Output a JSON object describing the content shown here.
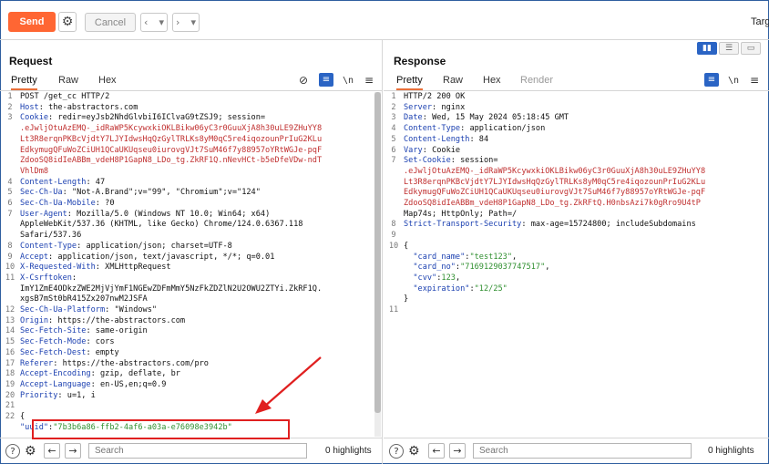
{
  "toolbar": {
    "send_label": "Send",
    "cancel_label": "Cancel",
    "target_label": "Targ",
    "icons": [
      "gear-icon",
      "chevron-left-icon",
      "chevron-right-icon"
    ]
  },
  "request": {
    "title": "Request",
    "tabs": [
      "Pretty",
      "Raw",
      "Hex"
    ],
    "active_tab": "Pretty",
    "search_placeholder": "Search",
    "highlights": "0 highlights",
    "lines": [
      {
        "n": "1",
        "text": "POST /get_cc HTTP/2"
      },
      {
        "n": "2",
        "key": "Host",
        "val": " the-abstractors.com"
      },
      {
        "n": "3",
        "key": "Cookie",
        "val": " redir=eyJsb2NhdGlvbiI6IClvaG9tZSJ9; session="
      },
      {
        "n": "",
        "cont": ".eJwljOtuAzEMQ-_idRaWP5KcywxkiOKLBikw06yC3r0GuuXjA8h30uLE9ZHuYY8"
      },
      {
        "n": "",
        "cont": "Lt3R8erqnPKBcVjdtY7LJYIdwsHqQzGylTRLKs8yM0qC5re4iqozounPrIuG2KLu"
      },
      {
        "n": "",
        "cont": "EdkymugQFuWoZCiUH1QCaUKUqseu0iurovgVJt7SuM46f7y88957oYRtWGJe-pqF"
      },
      {
        "n": "",
        "cont": "ZdooSQ8idIeABBm_vdeH8P1GapN8_LDo_tg.ZkRF1Q.nNevHCt-b5eDfeVDw-ndT"
      },
      {
        "n": "",
        "cont": "VhlDm8"
      },
      {
        "n": "4",
        "key": "Content-Length",
        "val": " 47"
      },
      {
        "n": "5",
        "key": "Sec-Ch-Ua",
        "val": " \"Not-A.Brand\";v=\"99\", \"Chromium\";v=\"124\""
      },
      {
        "n": "6",
        "key": "Sec-Ch-Ua-Mobile",
        "val": " ?0"
      },
      {
        "n": "7",
        "key": "User-Agent",
        "val": " Mozilla/5.0 (Windows NT 10.0; Win64; x64)"
      },
      {
        "n": "",
        "text": "AppleWebKit/537.36 (KHTML, like Gecko) Chrome/124.0.6367.118"
      },
      {
        "n": "",
        "text": "Safari/537.36"
      },
      {
        "n": "8",
        "key": "Content-Type",
        "val": " application/json; charset=UTF-8"
      },
      {
        "n": "9",
        "key": "Accept",
        "val": " application/json, text/javascript, */*; q=0.01"
      },
      {
        "n": "10",
        "key": "X-Requested-With",
        "val": " XMLHttpRequest"
      },
      {
        "n": "11",
        "key": "X-Csrftoken",
        "val": ""
      },
      {
        "n": "",
        "text": "ImY1ZmE4ODkzZWE2MjVjYmF1NGEwZDFmMmY5NzFkZDZlN2U2OWU2ZTYi.ZkRF1Q."
      },
      {
        "n": "",
        "text": "xgsB7mSt0bR415Zx207nwM2JSFA"
      },
      {
        "n": "12",
        "key": "Sec-Ch-Ua-Platform",
        "val": " \"Windows\""
      },
      {
        "n": "13",
        "key": "Origin",
        "val": " https://the-abstractors.com"
      },
      {
        "n": "14",
        "key": "Sec-Fetch-Site",
        "val": " same-origin"
      },
      {
        "n": "15",
        "key": "Sec-Fetch-Mode",
        "val": " cors"
      },
      {
        "n": "16",
        "key": "Sec-Fetch-Dest",
        "val": " empty"
      },
      {
        "n": "17",
        "key": "Referer",
        "val": " https://the-abstractors.com/pro"
      },
      {
        "n": "18",
        "key": "Accept-Encoding",
        "val": " gzip, deflate, br"
      },
      {
        "n": "19",
        "key": "Accept-Language",
        "val": " en-US,en;q=0.9"
      },
      {
        "n": "20",
        "key": "Priority",
        "val": " u=1, i"
      },
      {
        "n": "21",
        "text": ""
      },
      {
        "n": "22",
        "text": "{"
      },
      {
        "n": "",
        "jkey": "\"uuid\"",
        "jsep": ":",
        "jval": "\"7b3b6a86-ffb2-4af6-a03a-e76098e3942b\""
      }
    ]
  },
  "response": {
    "title": "Response",
    "tabs": [
      "Pretty",
      "Raw",
      "Hex",
      "Render"
    ],
    "active_tab": "Pretty",
    "search_placeholder": "Search",
    "highlights": "0 highlights",
    "lines": [
      {
        "n": "1",
        "text": "HTTP/2 200 OK"
      },
      {
        "n": "2",
        "key": "Server",
        "val": " nginx"
      },
      {
        "n": "3",
        "key": "Date",
        "val": " Wed, 15 May 2024 05:18:45 GMT"
      },
      {
        "n": "4",
        "key": "Content-Type",
        "val": " application/json"
      },
      {
        "n": "5",
        "key": "Content-Length",
        "val": " 84"
      },
      {
        "n": "6",
        "key": "Vary",
        "val": " Cookie"
      },
      {
        "n": "7",
        "key": "Set-Cookie",
        "val": " session="
      },
      {
        "n": "",
        "cont": ".eJwljOtuAzEMQ-_idRaWP5KcywxkiOKLBikw06yC3r0GuuXjA8h30uLE9ZHuYY8"
      },
      {
        "n": "",
        "cont": "Lt3R8erqnPKBcVjdtY7LJYIdwsHqQzGylTRLKs8yM0qC5re4iqozounPrIuG2KLu"
      },
      {
        "n": "",
        "cont": "EdkymugQFuWoZCiUH1QCaUKUqseu0iurovgVJt7SuM46f7y88957oYRtWGJe-pqF"
      },
      {
        "n": "",
        "cont": "ZdooSQ8idIeABBm_vdeH8P1GapN8_LDo_tg.ZkRFtQ.H0nbsAzi7k0gRro9U4tP"
      },
      {
        "n": "",
        "text": "Map74s; HttpOnly; Path=/"
      },
      {
        "n": "8",
        "key": "Strict-Transport-Security",
        "val": " max-age=15724800; includeSubdomains"
      },
      {
        "n": "9",
        "text": ""
      },
      {
        "n": "10",
        "text": "{"
      },
      {
        "n": "",
        "jkey": "  \"card_name\"",
        "jsep": ":",
        "jval": "\"test123\"",
        "jend": ","
      },
      {
        "n": "",
        "jkey": "  \"card_no\"",
        "jsep": ":",
        "jval": "\"7169129037747517\"",
        "jend": ","
      },
      {
        "n": "",
        "jkey": "  \"cvv\"",
        "jsep": ":",
        "jval": "123",
        "jend": ","
      },
      {
        "n": "",
        "jkey": "  \"expiration\"",
        "jsep": ":",
        "jval": "\"12/25\""
      },
      {
        "n": "",
        "text": "}"
      },
      {
        "n": "",
        "text": ""
      },
      {
        "n": "11",
        "text": ""
      }
    ]
  },
  "colors": {
    "accent": "#ff6633",
    "header_key": "#1a3fb0",
    "json_string": "#2f8f2f",
    "annotation": "#e02020",
    "toggle_active": "#2a64c4"
  }
}
